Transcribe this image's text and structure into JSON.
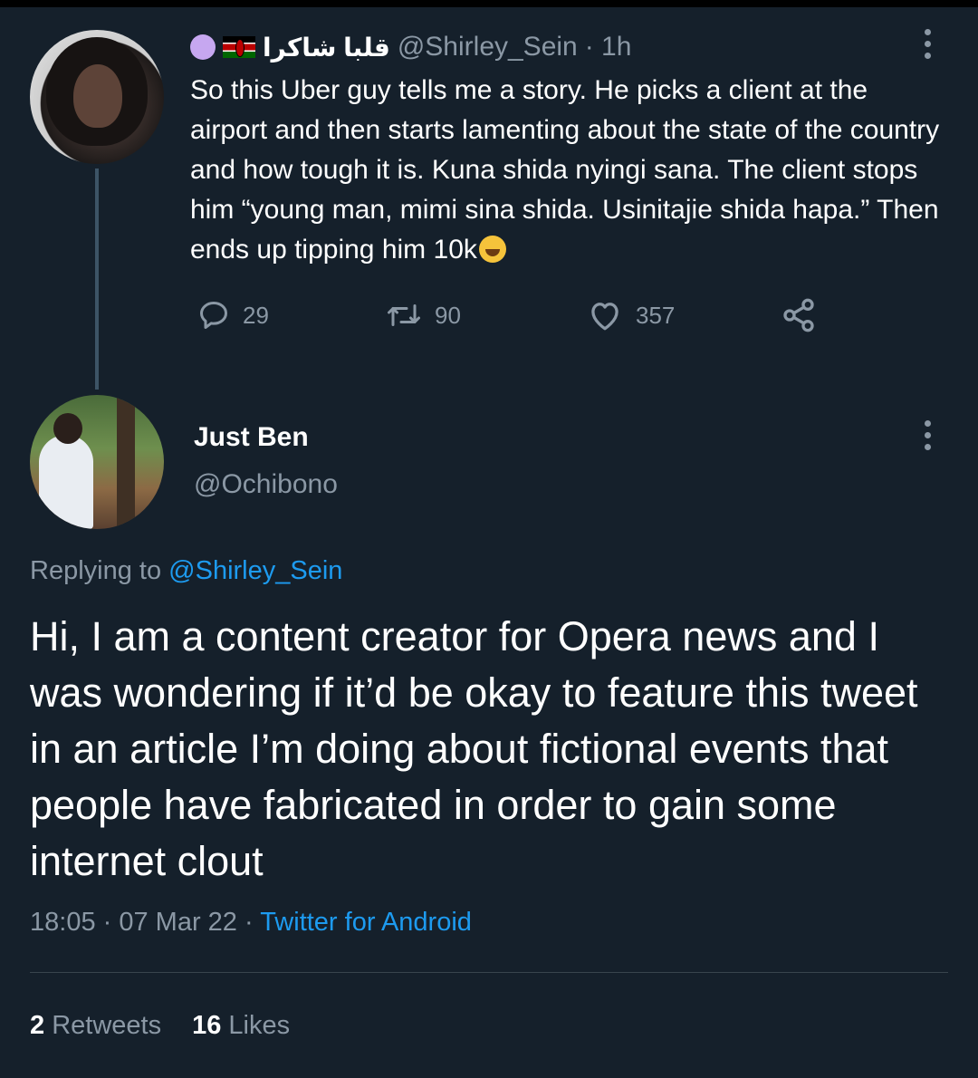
{
  "parent_tweet": {
    "display_name": "قلبا شاكرا",
    "handle": "@Shirley_Sein",
    "time": "· 1h",
    "text": "So this Uber guy tells me a story. He picks a client at the airport and then starts lamenting about the state of the country and how tough it is. Kuna shida nyingi sana. The client stops him “young man, mimi sina shida. Usinitajie shida hapa.” Then ends up tipping him 10k",
    "emoji_icons": [
      "purple-circle-icon",
      "kenya-flag-icon",
      "rolling-laughing-face-icon"
    ],
    "actions": {
      "replies": "29",
      "retweets": "90",
      "likes": "357"
    }
  },
  "reply_tweet": {
    "display_name": "Just Ben",
    "handle": "@Ochibono",
    "replying_prefix": "Replying to",
    "replying_to": "@Shirley_Sein",
    "text": "Hi, I am a content creator for Opera news and I was wondering if it’d be okay to feature this tweet in an article I’m doing about fictional events that people have fabricated in order to gain some internet clout",
    "timestamp": "18:05 · 07 Mar 22 ·",
    "source": "Twitter for Android",
    "retweets_count": "2",
    "retweets_label": "Retweets",
    "likes_count": "16",
    "likes_label": "Likes"
  },
  "colors": {
    "background": "#15202b",
    "text_primary": "#ffffff",
    "text_secondary": "#8b98a5",
    "link": "#1d9bf0",
    "divider": "#38444d"
  }
}
